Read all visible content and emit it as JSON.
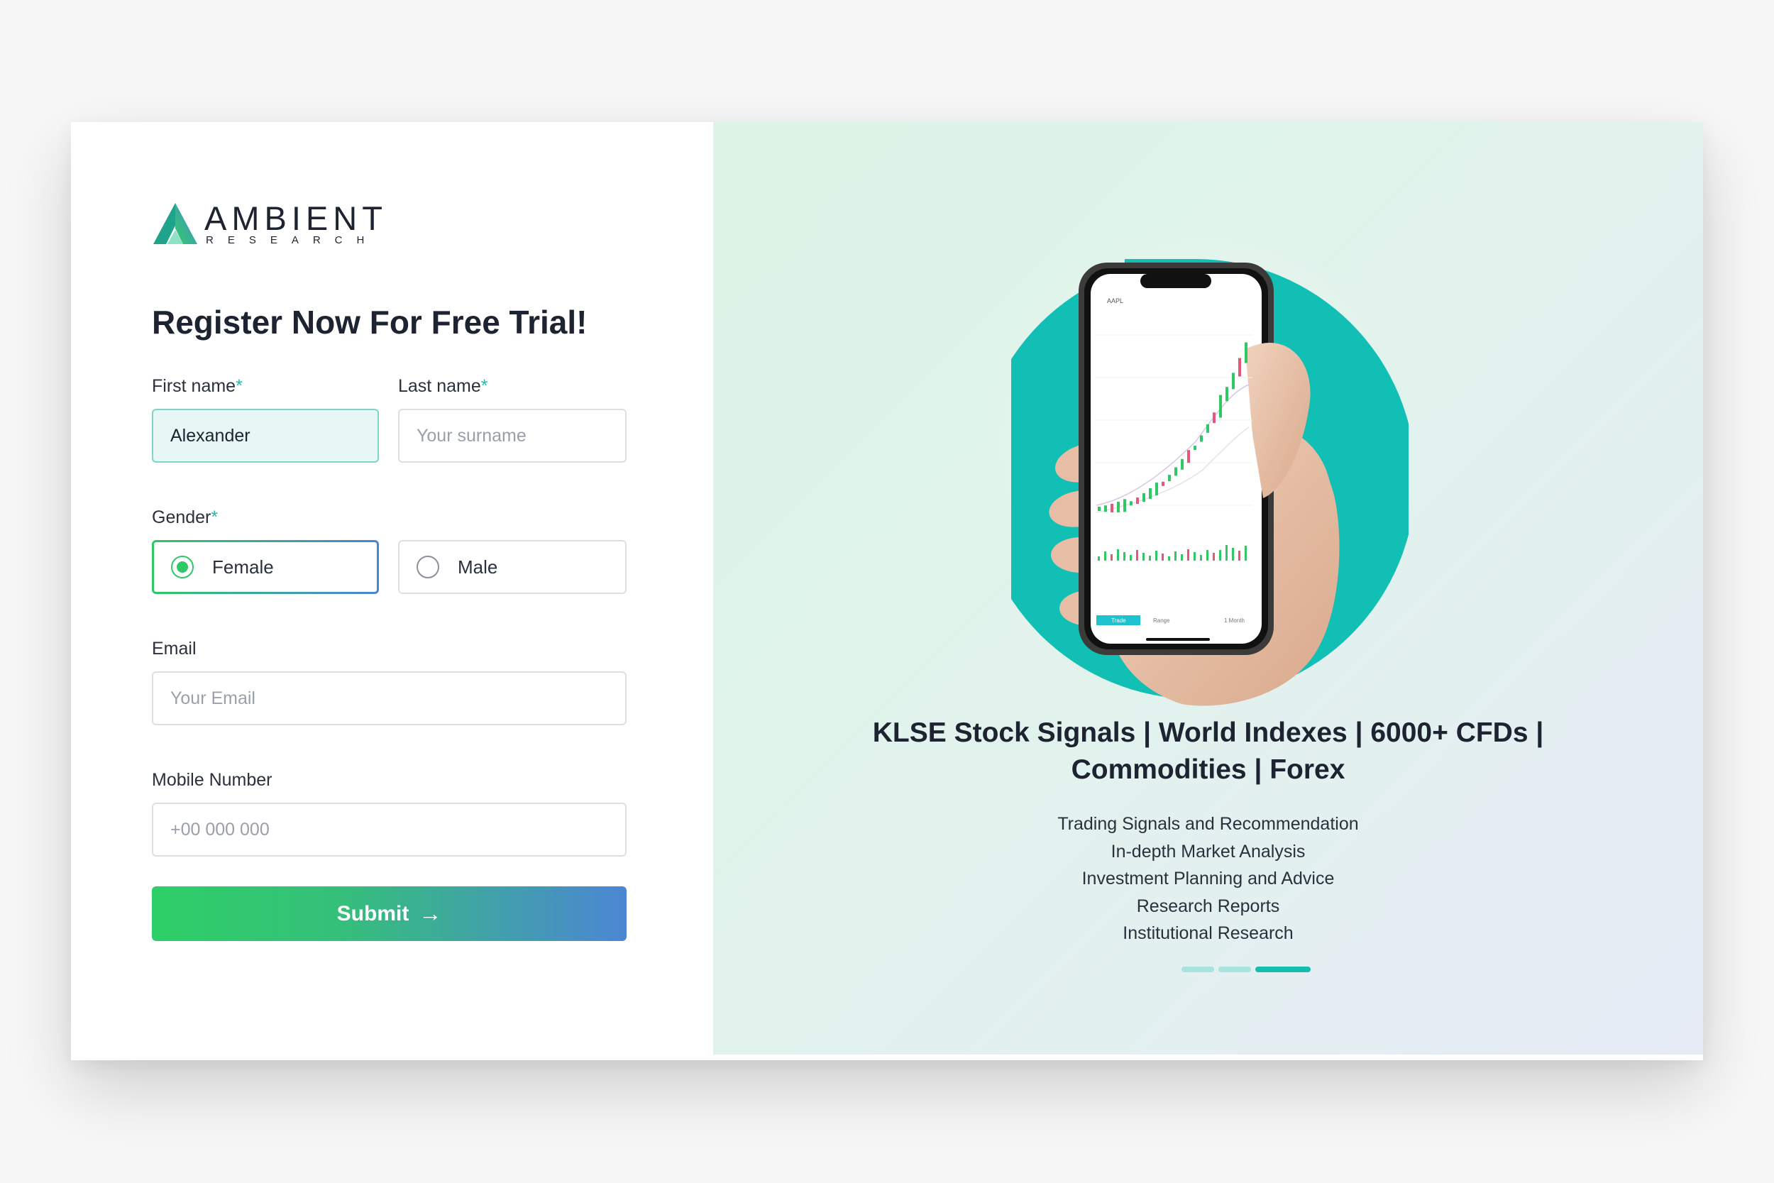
{
  "brand": {
    "name": "AMBIENT",
    "tagline": "RESEARCH"
  },
  "form": {
    "title": "Register Now For Free Trial!",
    "first_name": {
      "label": "First name",
      "value": "Alexander"
    },
    "last_name": {
      "label": "Last name",
      "placeholder": "Your surname"
    },
    "required_mark": "*",
    "gender": {
      "label": "Gender",
      "options": [
        "Female",
        "Male"
      ],
      "selected": "Female"
    },
    "email": {
      "label": "Email",
      "placeholder": "Your Email"
    },
    "mobile": {
      "label": "Mobile Number",
      "placeholder": "+00 000 000"
    },
    "submit_label": "Submit"
  },
  "promo": {
    "headline_line1": "KLSE Stock Signals | World Indexes | 6000+ CFDs |",
    "headline_line2": "Commodities | Forex",
    "features": [
      "Trading Signals and Recommendation",
      "In-depth Market Analysis",
      "Investment Planning and Advice",
      "Research Reports",
      "Institutional Research"
    ],
    "carousel": {
      "count": 3,
      "active_index": 2
    },
    "phone": {
      "ticker": "AAPL",
      "trade_label": "Trade",
      "range_label": "Range",
      "interval_label": "1 Month"
    }
  },
  "colors": {
    "accent": "#2ec866",
    "accent_end": "#4c86d4",
    "teal": "#12bfb4",
    "dark_circle": "#3a3b48"
  }
}
